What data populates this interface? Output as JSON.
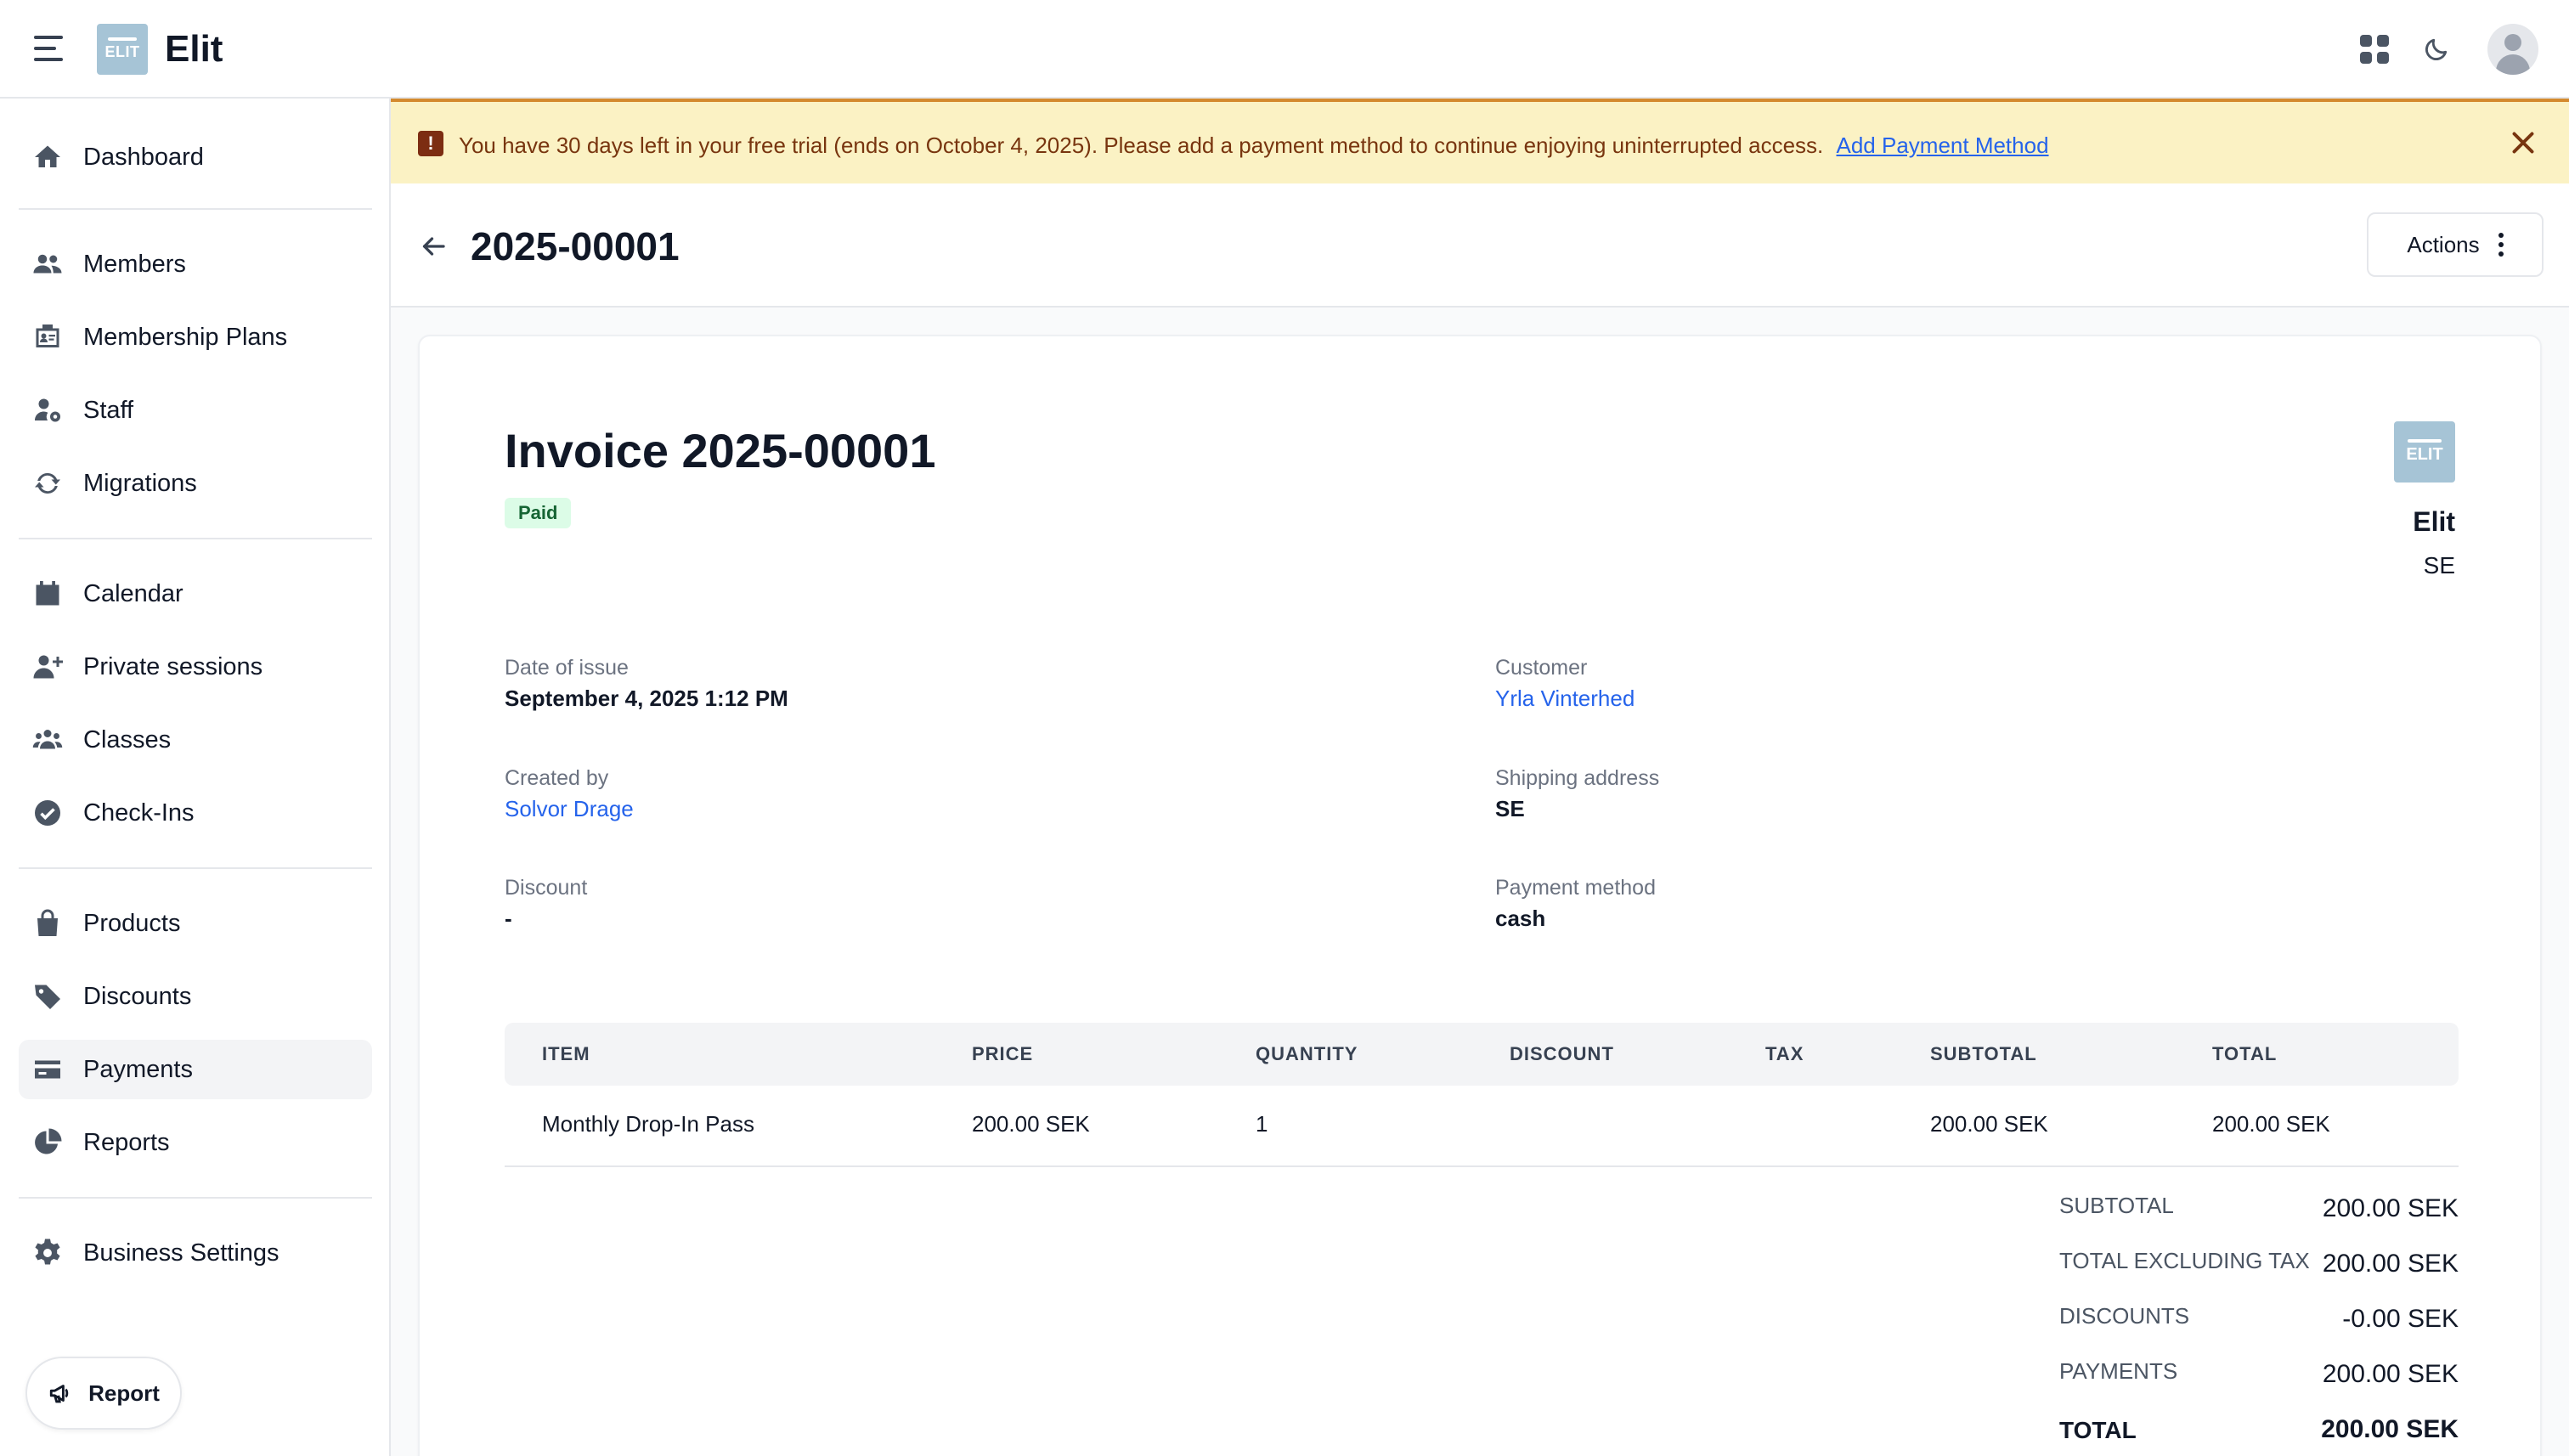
{
  "app": {
    "name": "Elit",
    "logo_text": "ELIT"
  },
  "sidebar": {
    "items": [
      {
        "label": "Dashboard",
        "icon": "home-icon"
      },
      {
        "label": "Members",
        "icon": "users-icon"
      },
      {
        "label": "Membership Plans",
        "icon": "id-card-icon"
      },
      {
        "label": "Staff",
        "icon": "user-gear-icon"
      },
      {
        "label": "Migrations",
        "icon": "sync-icon"
      },
      {
        "label": "Calendar",
        "icon": "calendar-icon"
      },
      {
        "label": "Private sessions",
        "icon": "user-plus-icon"
      },
      {
        "label": "Classes",
        "icon": "group-icon"
      },
      {
        "label": "Check-Ins",
        "icon": "check-circle-icon"
      },
      {
        "label": "Products",
        "icon": "shopping-bag-icon"
      },
      {
        "label": "Discounts",
        "icon": "tag-icon"
      },
      {
        "label": "Payments",
        "icon": "credit-card-icon"
      },
      {
        "label": "Reports",
        "icon": "pie-chart-icon"
      },
      {
        "label": "Business Settings",
        "icon": "gear-icon"
      }
    ],
    "active": "Payments",
    "report_label": "Report"
  },
  "banner": {
    "message": "You have 30 days left in your free trial (ends on October 4, 2025). Please add a payment method to continue enjoying uninterrupted access.",
    "link_label": "Add Payment Method",
    "accent_color": "#d48a2e",
    "bg_color": "#fbf2c4"
  },
  "header": {
    "title": "2025-00001",
    "actions_label": "Actions"
  },
  "invoice": {
    "title": "Invoice 2025-00001",
    "status": "Paid",
    "business": {
      "name": "Elit",
      "country": "SE"
    },
    "fields": {
      "date_of_issue": {
        "label": "Date of issue",
        "value": "September 4, 2025 1:12 PM"
      },
      "customer": {
        "label": "Customer",
        "value": "Yrla Vinterhed"
      },
      "created_by": {
        "label": "Created by",
        "value": "Solvor Drage"
      },
      "shipping_address": {
        "label": "Shipping address",
        "value": "SE"
      },
      "discount": {
        "label": "Discount",
        "value": "-"
      },
      "payment_method": {
        "label": "Payment method",
        "value": "cash"
      }
    },
    "table": {
      "columns": [
        "ITEM",
        "PRICE",
        "QUANTITY",
        "DISCOUNT",
        "TAX",
        "SUBTOTAL",
        "TOTAL"
      ],
      "rows": [
        {
          "item": "Monthly Drop-In Pass",
          "price": "200.00 SEK",
          "quantity": "1",
          "discount": "",
          "tax": "",
          "subtotal": "200.00 SEK",
          "total": "200.00 SEK"
        }
      ]
    },
    "totals": [
      {
        "label": "SUBTOTAL",
        "value": "200.00 SEK"
      },
      {
        "label": "TOTAL EXCLUDING TAX",
        "value": "200.00 SEK"
      },
      {
        "label": "DISCOUNTS",
        "value": "-0.00 SEK"
      },
      {
        "label": "PAYMENTS",
        "value": "200.00 SEK"
      },
      {
        "label": "TOTAL",
        "value": "200.00 SEK"
      }
    ]
  }
}
